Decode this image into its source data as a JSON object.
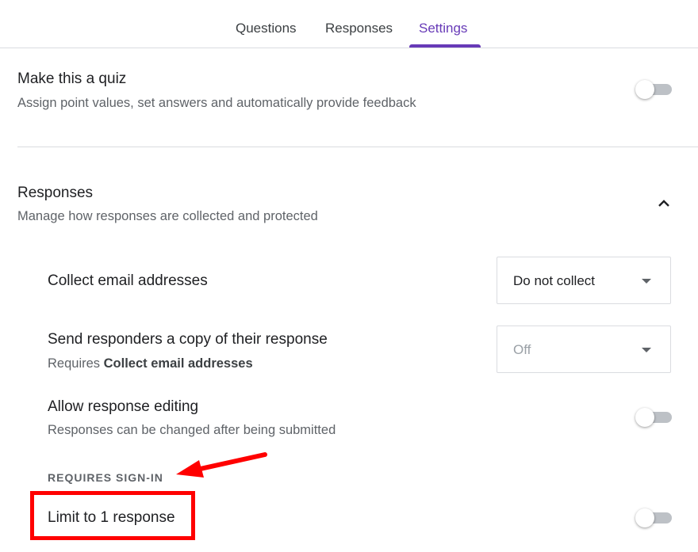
{
  "tabs": [
    {
      "label": "Questions"
    },
    {
      "label": "Responses"
    },
    {
      "label": "Settings"
    }
  ],
  "quiz": {
    "title": "Make this a quiz",
    "description": "Assign point values, set answers and automatically provide feedback",
    "enabled": false
  },
  "responses_section": {
    "title": "Responses",
    "description": "Manage how responses are collected and protected",
    "expanded": true,
    "collect_email": {
      "label": "Collect email addresses",
      "selected": "Do not collect"
    },
    "send_copy": {
      "label": "Send responders a copy of their response",
      "requires_prefix": "Requires ",
      "requires_bold": "Collect email addresses",
      "selected": "Off"
    },
    "allow_editing": {
      "label": "Allow response editing",
      "description": "Responses can be changed after being submitted",
      "enabled": false
    },
    "requires_signin_label": "REQUIRES SIGN-IN",
    "limit_response": {
      "label": "Limit to 1 response",
      "enabled": false
    }
  },
  "colors": {
    "accent": "#673ab7",
    "annotation": "#ff0000",
    "toggle_off_track": "#bdc1c6"
  }
}
